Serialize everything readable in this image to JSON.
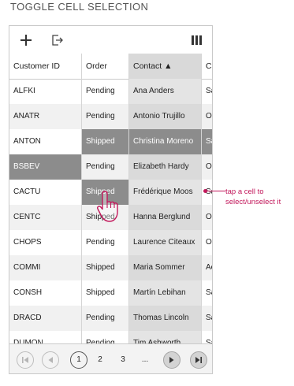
{
  "page": {
    "title": "TOGGLE CELL SELECTION"
  },
  "toolbar": {
    "icons": [
      "plus-icon",
      "export-icon",
      "column-chooser-icon"
    ]
  },
  "grid": {
    "columns": [
      {
        "label": "Customer ID"
      },
      {
        "label": "Order"
      },
      {
        "label": "Contact ▲",
        "sorted": "ascending"
      },
      {
        "label": "Co"
      }
    ],
    "rows": [
      {
        "id": "ALFKI",
        "order": "Pending",
        "contact": "Ana Anders",
        "co": "Sa",
        "selected": []
      },
      {
        "id": "ANATR",
        "order": "Pending",
        "contact": "Antonio Trujillo",
        "co": "O",
        "selected": []
      },
      {
        "id": "ANTON",
        "order": "Shipped",
        "contact": "Christina Moreno",
        "co": "Sa",
        "selected": [
          "order",
          "contact",
          "co"
        ]
      },
      {
        "id": "BSBEV",
        "order": "Pending",
        "contact": "Elizabeth Hardy",
        "co": "O",
        "selected": [
          "id"
        ]
      },
      {
        "id": "CACTU",
        "order": "Shipped",
        "contact": "Frédérique Moos",
        "co": "Sa",
        "selected": [
          "order"
        ]
      },
      {
        "id": "CENTC",
        "order": "Shipped",
        "contact": "Hanna Berglund",
        "co": "O",
        "selected": []
      },
      {
        "id": "CHOPS",
        "order": "Pending",
        "contact": "Laurence Citeaux",
        "co": "O",
        "selected": []
      },
      {
        "id": "COMMI",
        "order": "Shipped",
        "contact": "Maria Sommer",
        "co": "Ac",
        "selected": []
      },
      {
        "id": "CONSH",
        "order": "Shipped",
        "contact": "Martín Lebihan",
        "co": "Sa",
        "selected": []
      },
      {
        "id": "DRACD",
        "order": "Pending",
        "contact": "Thomas Lincoln",
        "co": "Sa",
        "selected": []
      },
      {
        "id": "DUMON",
        "order": "Pending",
        "contact": "Tim Ashworth",
        "co": "Sa",
        "selected": []
      }
    ]
  },
  "pager": {
    "pages": [
      "1",
      "2",
      "3",
      "..."
    ],
    "current": "1"
  },
  "annotation": {
    "line1": "tap a cell to",
    "line2": "select/unselect it"
  },
  "colors": {
    "selected": "#8c8c8c",
    "sorted_header": "#d9d9d9",
    "annotation": "#c2185b"
  }
}
